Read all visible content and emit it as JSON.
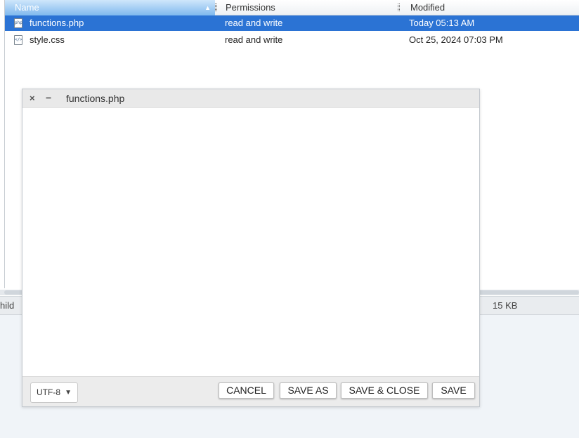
{
  "columns": {
    "name": "Name",
    "permissions": "Permissions",
    "modified": "Modified"
  },
  "files": [
    {
      "name": "functions.php",
      "permissions": "read and write",
      "modified": "Today 05:13 AM",
      "icon": "php-file-icon",
      "selected": true
    },
    {
      "name": "style.css",
      "permissions": "read and write",
      "modified": "Oct 25, 2024 07:03 PM",
      "icon": "css-file-icon",
      "selected": false
    }
  ],
  "statusbar": {
    "left_text": "hild",
    "size_text": "15 KB"
  },
  "dialog": {
    "title": "functions.php",
    "close_icon": "×",
    "minimize_icon": "−",
    "editor_content": "",
    "encoding": "UTF-8",
    "buttons": {
      "cancel": "CANCEL",
      "save_as": "SAVE AS",
      "save_close": "SAVE & CLOSE",
      "save": "SAVE"
    }
  },
  "colors": {
    "selection": "#2b73d4",
    "header_active": "#7fb9ee"
  }
}
